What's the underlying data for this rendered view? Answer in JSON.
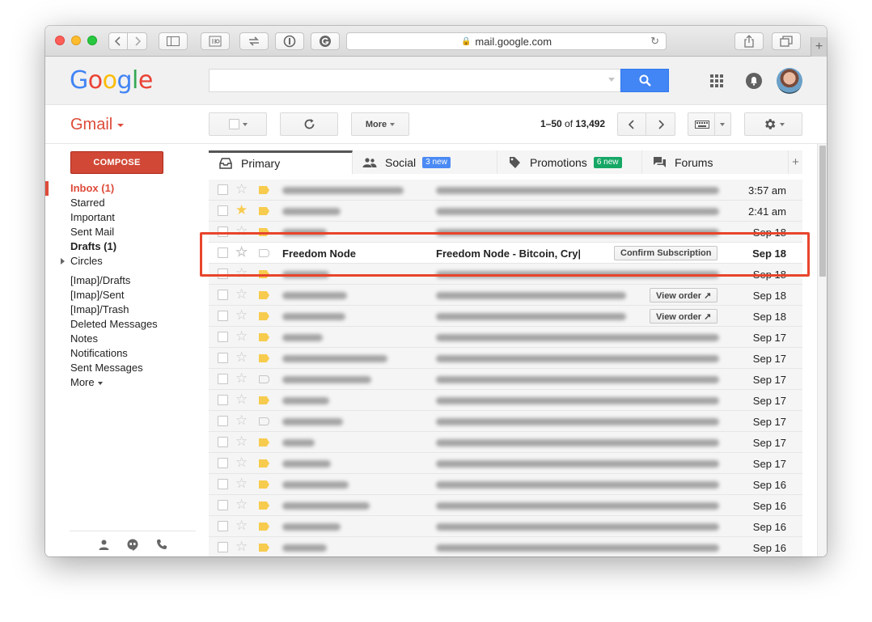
{
  "browser": {
    "url": "mail.google.com"
  },
  "header": {
    "logo_letters": [
      "G",
      "o",
      "o",
      "g",
      "l",
      "e"
    ],
    "search_placeholder": ""
  },
  "gmail": {
    "label": "Gmail",
    "more_label": "More",
    "pager_range": "1–50",
    "pager_of": "of",
    "pager_total": "13,492"
  },
  "sidebar": {
    "compose_label": "COMPOSE",
    "items": [
      {
        "label": "Inbox (1)",
        "state": "active"
      },
      {
        "label": "Starred",
        "state": ""
      },
      {
        "label": "Important",
        "state": ""
      },
      {
        "label": "Sent Mail",
        "state": ""
      },
      {
        "label": "Drafts (1)",
        "state": "bold"
      },
      {
        "label": "Circles",
        "state": "expandable"
      },
      {
        "label": "[Imap]/Drafts",
        "state": ""
      },
      {
        "label": "[Imap]/Sent",
        "state": ""
      },
      {
        "label": "[Imap]/Trash",
        "state": ""
      },
      {
        "label": "Deleted Messages",
        "state": ""
      },
      {
        "label": "Notes",
        "state": ""
      },
      {
        "label": "Notifications",
        "state": ""
      },
      {
        "label": "Sent Messages",
        "state": ""
      },
      {
        "label": "More",
        "state": "dropdown"
      }
    ]
  },
  "tabs": [
    {
      "label": "Primary",
      "badge": "",
      "badge_color": "",
      "icon": "inbox-icon"
    },
    {
      "label": "Social",
      "badge": "3 new",
      "badge_color": "#4a8af4",
      "icon": "people-icon"
    },
    {
      "label": "Promotions",
      "badge": "6 new",
      "badge_color": "#16a765",
      "icon": "tag-icon"
    },
    {
      "label": "Forums",
      "badge": "",
      "badge_color": "",
      "icon": "chat-icon"
    }
  ],
  "emails": [
    {
      "sender": "",
      "subject": "",
      "action": "",
      "date": "3:57 am",
      "starred": false,
      "label": "yellow",
      "unread": false,
      "blurred": true
    },
    {
      "sender": "",
      "subject": "",
      "action": "",
      "date": "2:41 am",
      "starred": true,
      "label": "yellow",
      "unread": false,
      "blurred": true
    },
    {
      "sender": "",
      "subject": "",
      "action": "",
      "date": "Sep 18",
      "starred": false,
      "label": "yellow",
      "unread": false,
      "blurred": true
    },
    {
      "sender": "Freedom Node",
      "subject": "Freedom Node - Bitcoin, Cry|",
      "action": "Confirm Subscription",
      "date": "Sep 18",
      "starred": false,
      "label": "empty",
      "unread": true,
      "blurred": false
    },
    {
      "sender": "",
      "subject": "",
      "action": "",
      "date": "Sep 18",
      "starred": false,
      "label": "yellow",
      "unread": false,
      "blurred": true
    },
    {
      "sender": "",
      "subject": "",
      "action": "View order ↗",
      "date": "Sep 18",
      "starred": false,
      "label": "yellow",
      "unread": false,
      "blurred": true
    },
    {
      "sender": "",
      "subject": "",
      "action": "View order ↗",
      "date": "Sep 18",
      "starred": false,
      "label": "yellow",
      "unread": false,
      "blurred": true
    },
    {
      "sender": "",
      "subject": "",
      "action": "",
      "date": "Sep 17",
      "starred": false,
      "label": "yellow",
      "unread": false,
      "blurred": true
    },
    {
      "sender": "",
      "subject": "",
      "action": "",
      "date": "Sep 17",
      "starred": false,
      "label": "yellow",
      "unread": false,
      "blurred": true
    },
    {
      "sender": "",
      "subject": "",
      "action": "",
      "date": "Sep 17",
      "starred": false,
      "label": "empty",
      "unread": false,
      "blurred": true
    },
    {
      "sender": "",
      "subject": "",
      "action": "",
      "date": "Sep 17",
      "starred": false,
      "label": "yellow",
      "unread": false,
      "blurred": true
    },
    {
      "sender": "",
      "subject": "",
      "action": "",
      "date": "Sep 17",
      "starred": false,
      "label": "empty",
      "unread": false,
      "blurred": true
    },
    {
      "sender": "",
      "subject": "",
      "action": "",
      "date": "Sep 17",
      "starred": false,
      "label": "yellow",
      "unread": false,
      "blurred": true
    },
    {
      "sender": "",
      "subject": "",
      "action": "",
      "date": "Sep 17",
      "starred": false,
      "label": "yellow",
      "unread": false,
      "blurred": true
    },
    {
      "sender": "",
      "subject": "",
      "action": "",
      "date": "Sep 16",
      "starred": false,
      "label": "yellow",
      "unread": false,
      "blurred": true
    },
    {
      "sender": "",
      "subject": "",
      "action": "",
      "date": "Sep 16",
      "starred": false,
      "label": "yellow",
      "unread": false,
      "blurred": true
    },
    {
      "sender": "",
      "subject": "",
      "action": "",
      "date": "Sep 16",
      "starred": false,
      "label": "yellow",
      "unread": false,
      "blurred": true
    },
    {
      "sender": "",
      "subject": "",
      "action": "",
      "date": "Sep 16",
      "starred": false,
      "label": "yellow",
      "unread": false,
      "blurred": true
    }
  ],
  "colors": {
    "accent_red": "#dd4b39",
    "compose_red": "#d14836",
    "search_blue": "#4285f4",
    "highlight_box": "#e8452c",
    "star_yellow": "#f7cb4d"
  }
}
